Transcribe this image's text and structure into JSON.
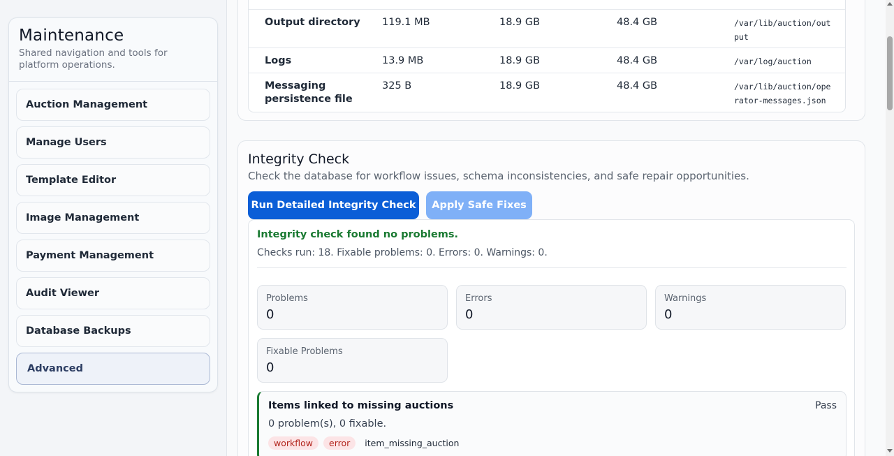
{
  "sidebar": {
    "title": "Maintenance",
    "subtitle": "Shared navigation and tools for platform operations.",
    "items": [
      {
        "label": "Auction Management"
      },
      {
        "label": "Manage Users"
      },
      {
        "label": "Template Editor"
      },
      {
        "label": "Image Management"
      },
      {
        "label": "Payment Management"
      },
      {
        "label": "Audit Viewer"
      },
      {
        "label": "Database Backups"
      },
      {
        "label": "Advanced"
      }
    ],
    "active_item": "Advanced"
  },
  "storage_table": {
    "rows": [
      {
        "name": "Output directory",
        "used": "119.1 MB",
        "free": "18.9 GB",
        "total": "48.4 GB",
        "path": "/var/lib/auction/out\nput"
      },
      {
        "name": "Logs",
        "used": "13.9 MB",
        "free": "18.9 GB",
        "total": "48.4 GB",
        "path": "/var/log/auction"
      },
      {
        "name": "Messaging persistence file",
        "used": "325 B",
        "free": "18.9 GB",
        "total": "48.4 GB",
        "path": "/var/lib/auction/ope\nrator-messages.json"
      }
    ]
  },
  "integrity": {
    "title": "Integrity Check",
    "description": "Check the database for workflow issues, schema inconsistencies, and safe repair opportunities.",
    "run_button": "Run Detailed Integrity Check",
    "fix_button": "Apply Safe Fixes",
    "result_headline": "Integrity check found no problems.",
    "result_summary": "Checks run: 18. Fixable problems: 0. Errors: 0. Warnings: 0.",
    "stats": {
      "problems": {
        "label": "Problems",
        "value": "0"
      },
      "errors": {
        "label": "Errors",
        "value": "0"
      },
      "warnings": {
        "label": "Warnings",
        "value": "0"
      },
      "fixable": {
        "label": "Fixable Problems",
        "value": "0"
      }
    },
    "checks": [
      {
        "title": "Items linked to missing auctions",
        "status": "Pass",
        "count": "0 problem(s), 0 fixable.",
        "tags": [
          "workflow",
          "error"
        ],
        "code": "item_missing_auction"
      }
    ]
  },
  "colors": {
    "primary": "#0b5ed7",
    "primary_disabled": "#7fb0f7",
    "success": "#1a7a32",
    "tag_bg": "#fce4e6",
    "tag_text": "#b3261e"
  }
}
